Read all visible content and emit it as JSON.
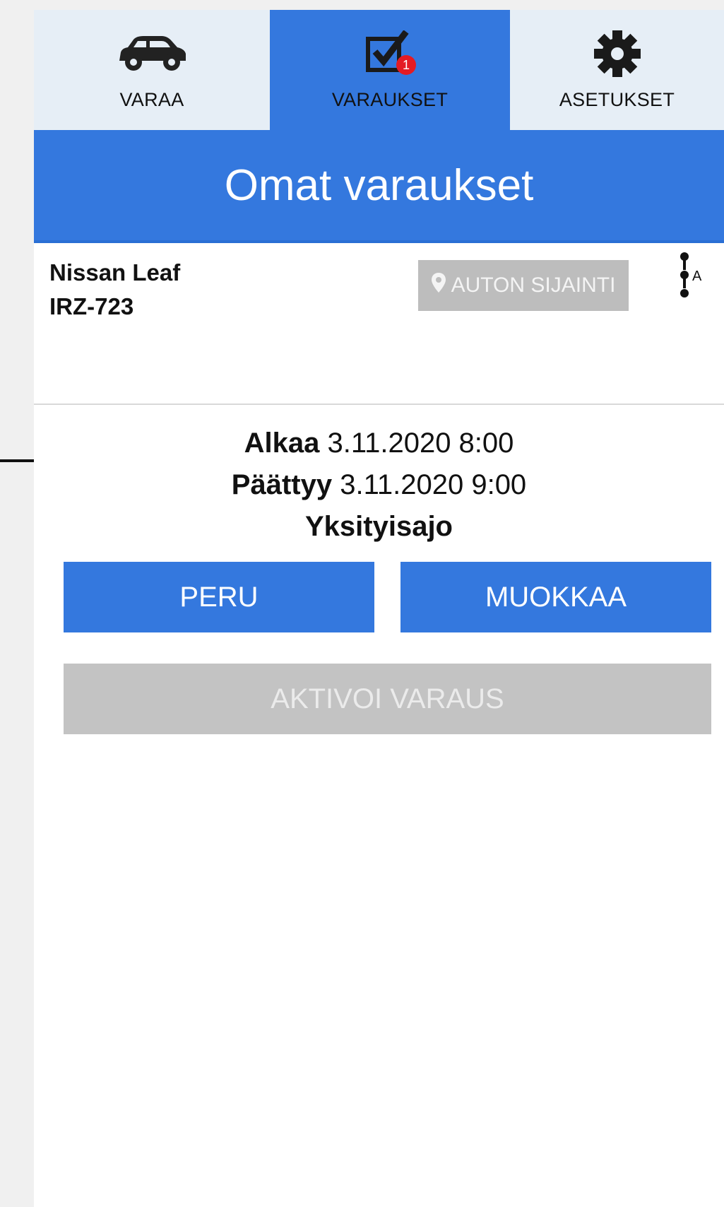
{
  "tabs": [
    {
      "label": "VARAA",
      "icon": "car-icon",
      "active": false
    },
    {
      "label": "VARAUKSET",
      "icon": "checkbox-icon",
      "active": true,
      "badge": "1"
    },
    {
      "label": "ASETUKSET",
      "icon": "gear-icon",
      "active": false
    }
  ],
  "header": {
    "title": "Omat varaukset"
  },
  "reservation": {
    "car_model": "Nissan Leaf",
    "plate": "IRZ-723",
    "location_button": "AUTON SIJAINTI",
    "menu_letter": "A",
    "start_label": "Alkaa",
    "start_value": "3.11.2020 8:00",
    "end_label": "Päättyy",
    "end_value": "3.11.2020 9:00",
    "type": "Yksityisajo"
  },
  "actions": {
    "cancel": "PERU",
    "edit": "MUOKKAA",
    "activate": "AKTIVOI VARAUS"
  },
  "colors": {
    "accent": "#3478de",
    "badge": "#e41b23",
    "disabled": "#bdbdbd"
  }
}
